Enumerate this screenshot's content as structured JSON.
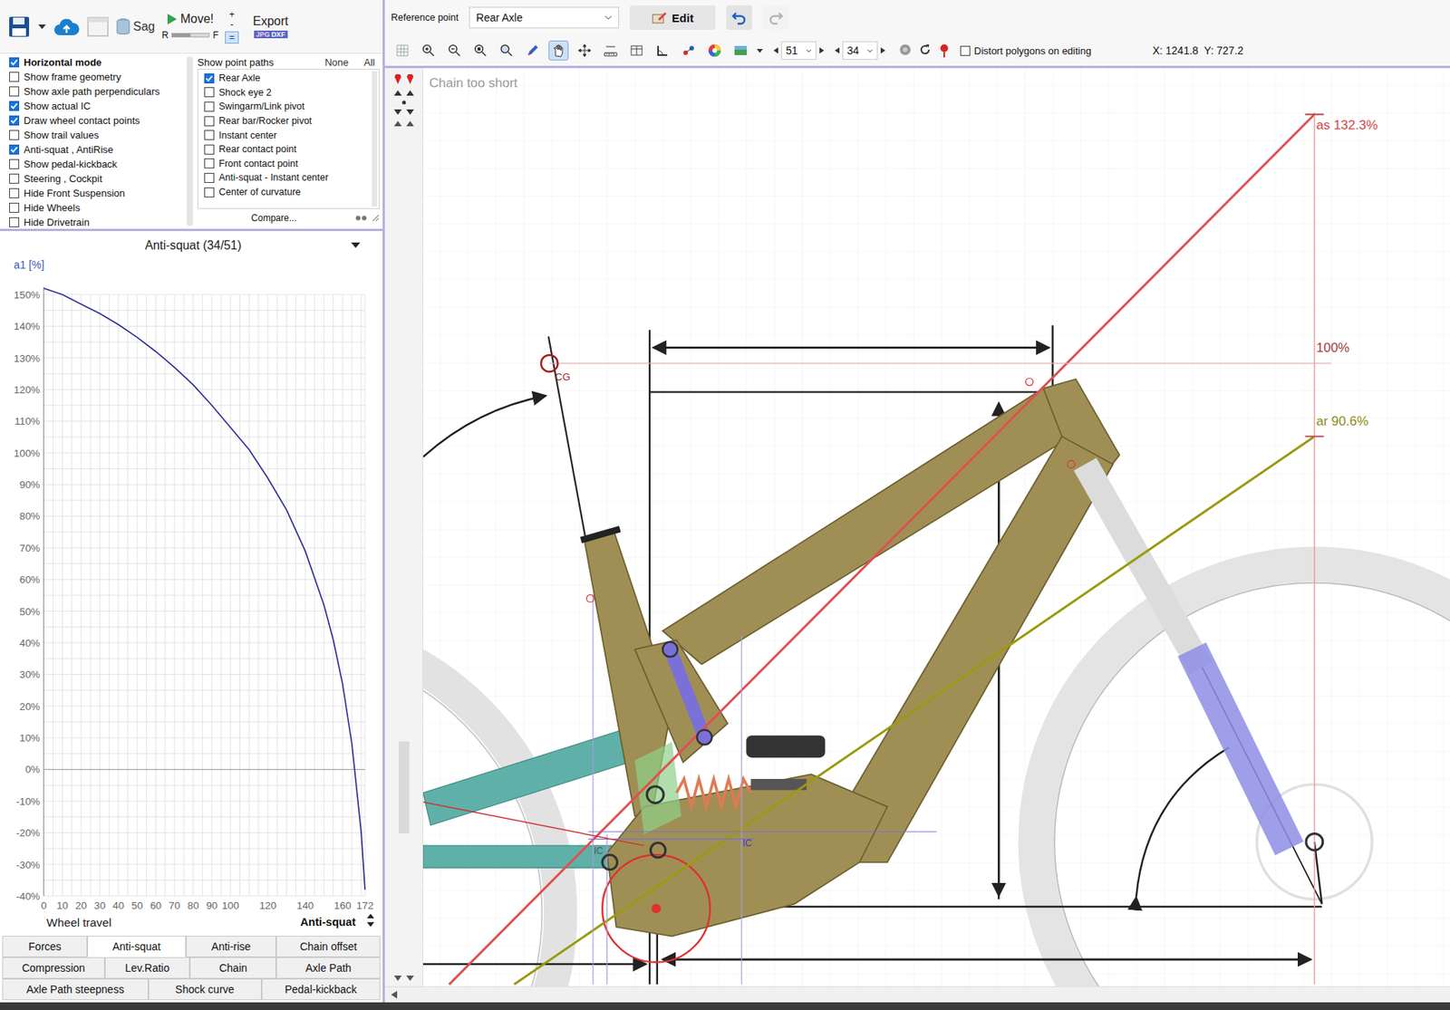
{
  "toolbar": {
    "sag": "Sag",
    "move": "Move!",
    "rear_label": "R",
    "front_label": "F",
    "slider": {
      "level": 0.5
    },
    "plus": "+",
    "minus": "-",
    "equals": "=",
    "export": "Export",
    "formats": [
      "JPG",
      "DXF"
    ]
  },
  "options": [
    {
      "label": "Horizontal mode",
      "checked": true,
      "bold": true
    },
    {
      "label": "Show frame geometry",
      "checked": false,
      "bold": false
    },
    {
      "label": "Show axle path perpendiculars",
      "checked": false,
      "bold": false
    },
    {
      "label": "Show actual IC",
      "checked": true,
      "bold": false
    },
    {
      "label": "Draw wheel contact points",
      "checked": true,
      "bold": false
    },
    {
      "label": "Show trail values",
      "checked": false,
      "bold": false
    },
    {
      "label": "Anti-squat , AntiRise",
      "checked": true,
      "bold": false
    },
    {
      "label": "Show pedal-kickback",
      "checked": false,
      "bold": false
    },
    {
      "label": "Steering , Cockpit",
      "checked": false,
      "bold": false
    },
    {
      "label": "Hide Front Suspension",
      "checked": false,
      "bold": false
    },
    {
      "label": "Hide Wheels",
      "checked": false,
      "bold": false
    },
    {
      "label": "Hide Drivetrain",
      "checked": false,
      "bold": false
    }
  ],
  "point_paths": {
    "title": "Show point paths",
    "none": "None",
    "all": "All",
    "compare": "Compare...",
    "items": [
      {
        "label": "Rear Axle",
        "checked": true
      },
      {
        "label": "Shock eye 2",
        "checked": false
      },
      {
        "label": "Swingarm/Link pivot",
        "checked": false
      },
      {
        "label": "Rear bar/Rocker pivot",
        "checked": false
      },
      {
        "label": "Instant center",
        "checked": false
      },
      {
        "label": "Rear contact point",
        "checked": false
      },
      {
        "label": "Front contact point",
        "checked": false
      },
      {
        "label": "Anti-squat - Instant center",
        "checked": false
      },
      {
        "label": "Center of curvature",
        "checked": false
      }
    ]
  },
  "chart": {
    "title": "Anti-squat (34/51)",
    "y_label": "a1 [%]",
    "x_label": "Wheel travel",
    "selector": "Anti-squat",
    "y_ticks": [
      {
        "label": "150%",
        "value": 150
      },
      {
        "label": "140%",
        "value": 140
      },
      {
        "label": "130%",
        "value": 130
      },
      {
        "label": "120%",
        "value": 120
      },
      {
        "label": "110%",
        "value": 110
      },
      {
        "label": "100%",
        "value": 100
      },
      {
        "label": "90%",
        "value": 90
      },
      {
        "label": "80%",
        "value": 80
      },
      {
        "label": "70%",
        "value": 70
      },
      {
        "label": "60%",
        "value": 60
      },
      {
        "label": "50%",
        "value": 50
      },
      {
        "label": "40%",
        "value": 40
      },
      {
        "label": "30%",
        "value": 30
      },
      {
        "label": "20%",
        "value": 20
      },
      {
        "label": "10%",
        "value": 10
      },
      {
        "label": "0%",
        "value": 0
      },
      {
        "label": "-10%",
        "value": -10
      },
      {
        "label": "-20%",
        "value": -20
      },
      {
        "label": "-30%",
        "value": -30
      },
      {
        "label": "-40%",
        "value": -40
      }
    ],
    "x_ticks": [
      {
        "label": "0",
        "value": 0
      },
      {
        "label": "10",
        "value": 10
      },
      {
        "label": "20",
        "value": 20
      },
      {
        "label": "30",
        "value": 30
      },
      {
        "label": "40",
        "value": 40
      },
      {
        "label": "50",
        "value": 50
      },
      {
        "label": "60",
        "value": 60
      },
      {
        "label": "70",
        "value": 70
      },
      {
        "label": "80",
        "value": 80
      },
      {
        "label": "90",
        "value": 90
      },
      {
        "label": "100",
        "value": 100
      },
      {
        "label": "120",
        "value": 120
      },
      {
        "label": "140",
        "value": 140
      },
      {
        "label": "160",
        "value": 160
      },
      {
        "label": "172",
        "value": 172
      }
    ],
    "series": [
      {
        "name": "Anti-squat",
        "color": "#2e2e9a",
        "x": [
          0,
          10,
          20,
          30,
          40,
          50,
          60,
          70,
          80,
          90,
          100,
          110,
          120,
          130,
          140,
          150,
          155,
          160,
          165,
          170,
          172
        ],
        "y": [
          152,
          150,
          147,
          144,
          140.5,
          136.5,
          132,
          127,
          121.5,
          115,
          108,
          101,
          92,
          82,
          69,
          52,
          41,
          27,
          8,
          -20,
          -38
        ]
      }
    ]
  },
  "tab_rows": [
    [
      {
        "label": "Forces",
        "selected": false
      },
      {
        "label": "Anti-squat",
        "selected": true
      },
      {
        "label": "Anti-rise",
        "selected": false
      },
      {
        "label": "Chain offset",
        "selected": false
      }
    ],
    [
      {
        "label": "Compression",
        "selected": false
      },
      {
        "label": "Lev.Ratio",
        "selected": false
      },
      {
        "label": "Chain",
        "selected": false
      },
      {
        "label": "Axle Path",
        "selected": false
      }
    ],
    [
      {
        "label": "Axle Path steepness",
        "selected": false
      },
      {
        "label": "Shock curve",
        "selected": false
      },
      {
        "label": "Pedal-kickback",
        "selected": false
      }
    ]
  ],
  "reference_point": {
    "label": "Reference point",
    "value": "Rear Axle"
  },
  "edit": "Edit",
  "undo": {
    "disabled": false
  },
  "redo": {
    "disabled": true
  },
  "tools": {
    "pan_selected": true
  },
  "gears": {
    "rear": "51",
    "front": "34"
  },
  "distort": {
    "label": "Distort polygons on editing",
    "checked": false
  },
  "coords": "X: 1241.8  Y: 727.2",
  "canvas": {
    "message": "Chain too short",
    "labels": [
      {
        "text": "as 132.3%",
        "color": "#d04848"
      },
      {
        "text": "100%",
        "color": "#a03a3a"
      },
      {
        "text": "ar 90.6%",
        "color": "#8c8c12"
      },
      {
        "text": "CG",
        "color": "#a02828"
      },
      {
        "text": "IC",
        "color": "#555555"
      },
      {
        "text": "IC",
        "color": "#3a3ac0"
      }
    ]
  }
}
